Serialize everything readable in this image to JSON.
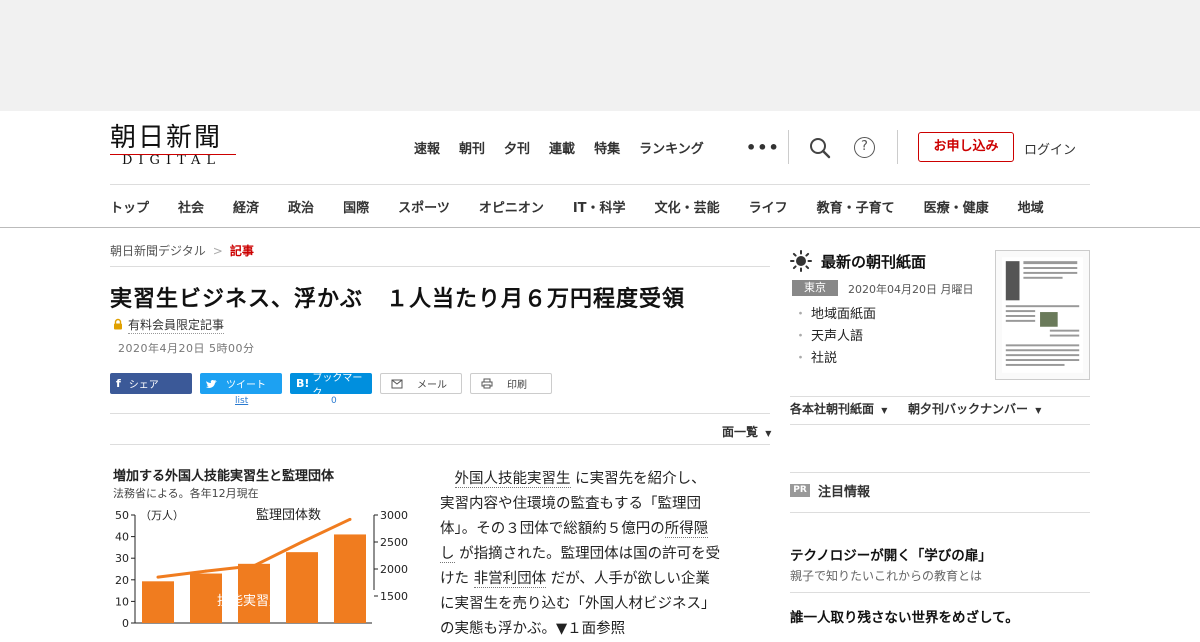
{
  "header": {
    "logo_main": "朝日新聞",
    "logo_sub": "DIGITAL",
    "top_nav": [
      "速報",
      "朝刊",
      "夕刊",
      "連載",
      "特集",
      "ランキング"
    ],
    "more": "•••",
    "help": "?",
    "subscribe_label": "お申し込み",
    "login_label": "ログイン",
    "categories": [
      "トップ",
      "社会",
      "経済",
      "政治",
      "国際",
      "スポーツ",
      "オピニオン",
      "IT・科学",
      "文化・芸能",
      "ライフ",
      "教育・子育て",
      "医療・健康",
      "地域"
    ]
  },
  "breadcrumb": {
    "home": "朝日新聞デジタル",
    "sep": ">",
    "current": "記事"
  },
  "article": {
    "title": "実習生ビジネス、浮かぶ　１人当たり月６万円程度受領",
    "members_only": "有料会員限定記事",
    "date": "2020年4月20日 5時00分",
    "share": {
      "facebook": "シェア",
      "twitter": "ツイート",
      "twitter_count": "list",
      "hatena": "ブックマーク",
      "hatena_count": "0",
      "mail": "メール",
      "print": "印刷"
    },
    "page_list": "面一覧",
    "body": {
      "l1_link": "外国人技能実習生",
      "l1_rest": " に実習先を紹介し、",
      "l2": "実習内容や住環境の監査もする「監理団",
      "l3_a": "体」。その３団体で総額約５億円の",
      "l3_link": "所得隠",
      "l4_link": "し",
      "l4_rest": " が指摘された。監理団体は国の許可を受",
      "l5_a": "けた ",
      "l5_link": "非営利団体",
      "l5_rest": " だが、人手が欲しい企業",
      "l6": "に実習生を売り込む「外国人材ビジネス」",
      "l7": "の実態も浮かぶ。▼１面参照"
    }
  },
  "chart_data": {
    "type": "bar",
    "title": "増加する外国人技能実習生と監理団体",
    "subtitle": "法務省による。各年12月現在",
    "left_unit": "（万人）",
    "left_ticks": [
      "50",
      "40",
      "30",
      "20",
      "10",
      "0"
    ],
    "right_ticks": [
      "3000",
      "2500",
      "2000",
      "1500"
    ],
    "categories": [
      "",
      "",
      "",
      "",
      ""
    ],
    "series": [
      {
        "name": "技能実習生",
        "type": "bar",
        "values": [
          19.3,
          22.9,
          27.4,
          32.8,
          41.0
        ],
        "color": "#f07c1f"
      },
      {
        "name": "監理団体数",
        "type": "line",
        "values": [
          1850,
          1960,
          2060,
          2500,
          2920
        ],
        "color": "#f07c1f"
      }
    ],
    "ylim_left": [
      0,
      50
    ],
    "ylim_right": [
      1000,
      3000
    ]
  },
  "sidebar": {
    "title": "最新の朝刊紙面",
    "region": "東京",
    "date": "2020年04月20日 月曜日",
    "links": [
      "地域面紙面",
      "天声人語",
      "社説"
    ],
    "dropdown1": "各本社朝刊紙面",
    "dropdown2": "朝夕刊バックナンバー",
    "pr_badge": "PR",
    "pr_title": "注目情報",
    "ad1_title": "テクノロジーが開く「学びの扉」",
    "ad1_sub": "親子で知りたいこれからの教育とは",
    "ad2_title": "誰一人取り残さない世界をめざして。"
  }
}
